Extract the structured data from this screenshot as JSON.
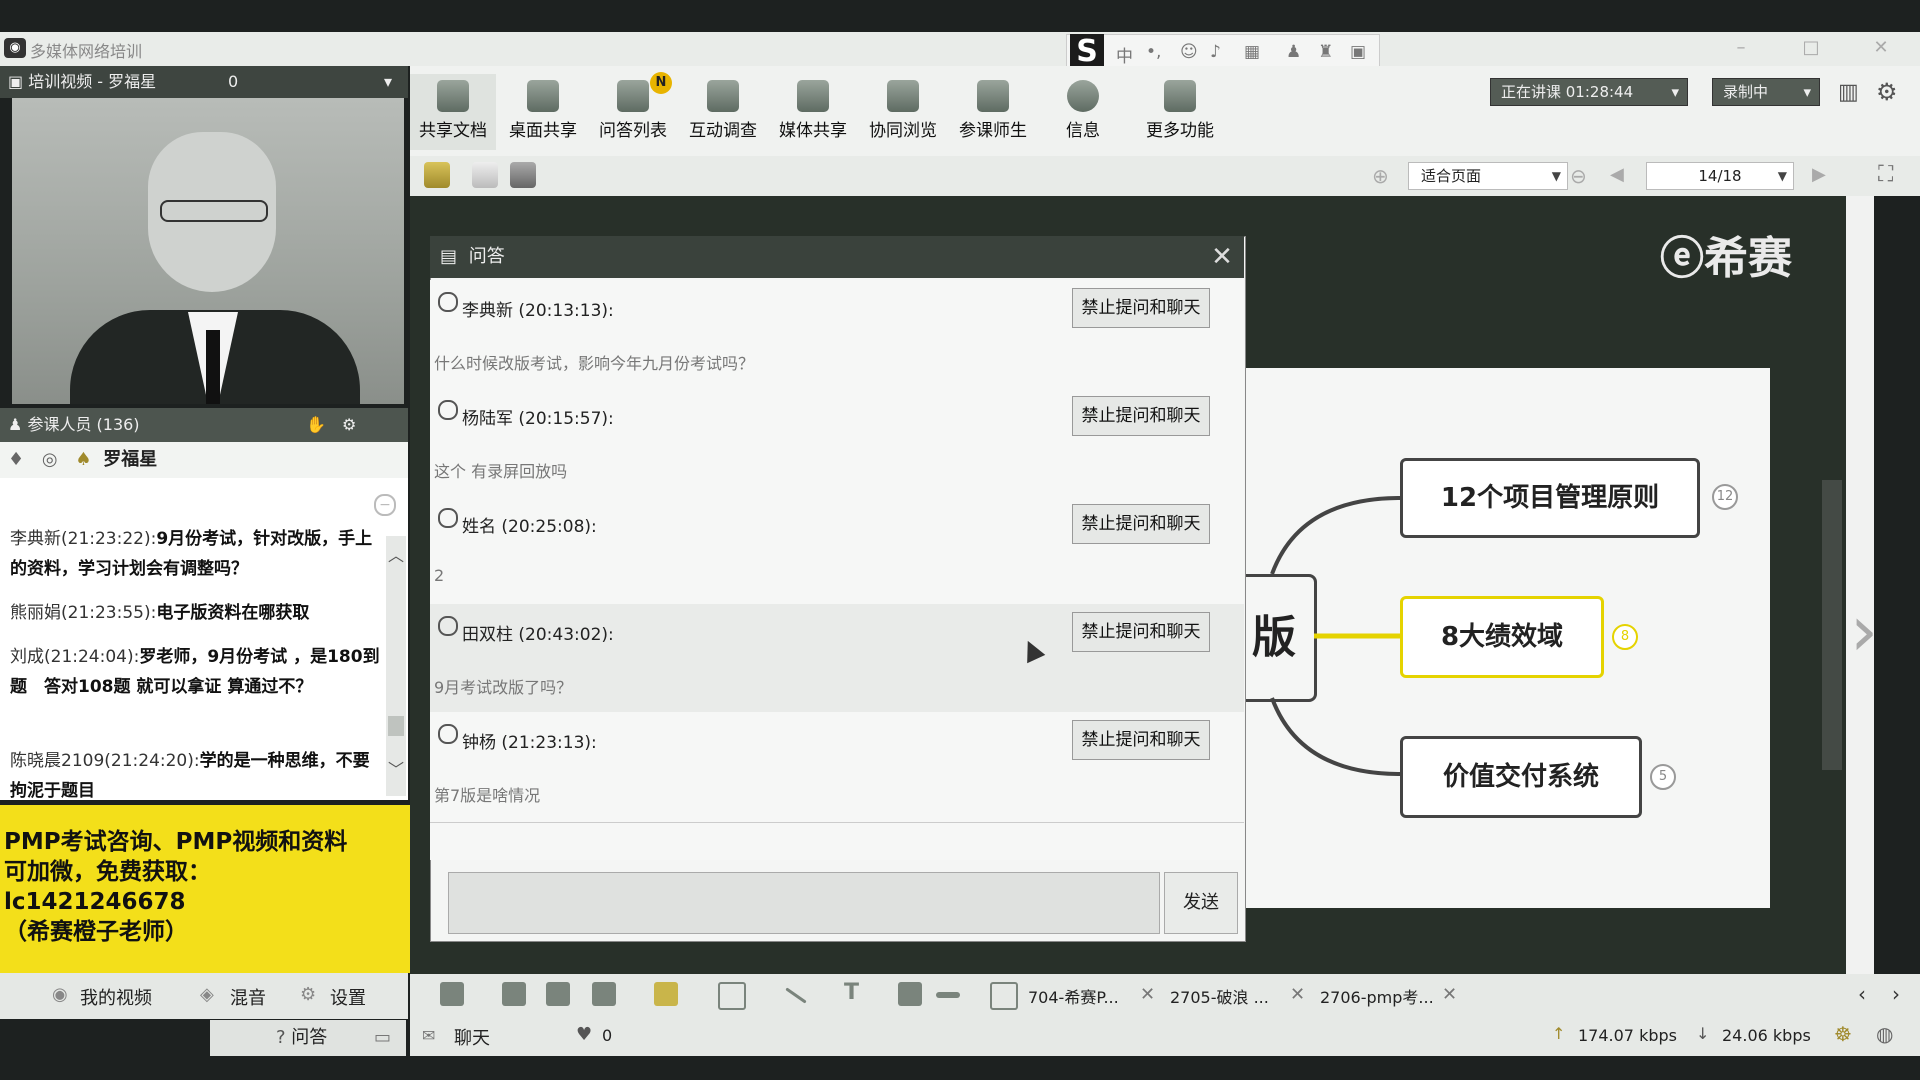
{
  "app": {
    "title": "多媒体网络培训"
  },
  "ime": {
    "mode_label": "中"
  },
  "toolbar": {
    "items": [
      {
        "label": "共享文档"
      },
      {
        "label": "桌面共享"
      },
      {
        "label": "问答列表"
      },
      {
        "label": "互动调查"
      },
      {
        "label": "媒体共享"
      },
      {
        "label": "协同浏览"
      },
      {
        "label": "参课师生"
      },
      {
        "label": "信息"
      },
      {
        "label": "更多功能"
      }
    ],
    "badge": "N",
    "status_label": "正在讲课 01:28:44",
    "record_label": "录制中"
  },
  "toolbar2": {
    "zoom_label": "适合页面",
    "page_label": "14/18"
  },
  "video": {
    "header": "培训视频 - 罗福星",
    "count": "0"
  },
  "attendees": {
    "label": "参课人员 (136)",
    "current_user": "罗福星"
  },
  "chat": {
    "messages": [
      {
        "name": "李典新(21:23:22):",
        "text": "9月份考试，针对改版，手上的资料，学习计划会有调整吗？"
      },
      {
        "name": "熊丽娟(21:23:55):",
        "text": "电子版资料在哪获取"
      },
      {
        "name": "刘成(21:24:04):",
        "text": "罗老师，9月份考试 ，是180到题　答对108题 就可以拿证 算通过不？"
      },
      {
        "name": "陈晓晨2109(21:24:20):",
        "text": "学的是一种思维，不要拘泥于题目"
      }
    ]
  },
  "promo": {
    "line1": "PMP考试咨询、PMP视频和资料",
    "line2": "可加微，免费获取：",
    "line3": "lc1421246678",
    "line4": "（希赛橙子老师）"
  },
  "left_bottom": {
    "my_video": "我的视频",
    "mix": "混音",
    "settings": "设置",
    "qa_tab": "问答"
  },
  "qa": {
    "title": "问答",
    "ban_label": "禁止提问和聊天",
    "send_label": "发送",
    "items": [
      {
        "name": "李典新 (20:13:13):",
        "text": "什么时候改版考试，影响今年九月份考试吗？"
      },
      {
        "name": "杨陆军 (20:15:57):",
        "text": "这个 有录屏回放吗"
      },
      {
        "name": "姓名 (20:25:08):",
        "text": "2"
      },
      {
        "name": "田双柱 (20:43:02):",
        "text": "9月考试改版了吗？"
      },
      {
        "name": "钟杨 (21:23:13):",
        "text": "第7版是啥情况"
      }
    ]
  },
  "slide": {
    "logo": "希赛",
    "partial_char": "版",
    "nodes": [
      {
        "label": "12个项目管理原则",
        "num": "12"
      },
      {
        "label": "8大绩效域",
        "num": "8"
      },
      {
        "label": "价值交付系统",
        "num": "5"
      }
    ]
  },
  "doc_tabs": [
    "704-希赛P...",
    "2705-破浪 ...",
    "2706-pmp考..."
  ],
  "status": {
    "chat_label": "聊天",
    "likes": "0",
    "upload": "174.07 kbps",
    "download": "24.06 kbps"
  }
}
